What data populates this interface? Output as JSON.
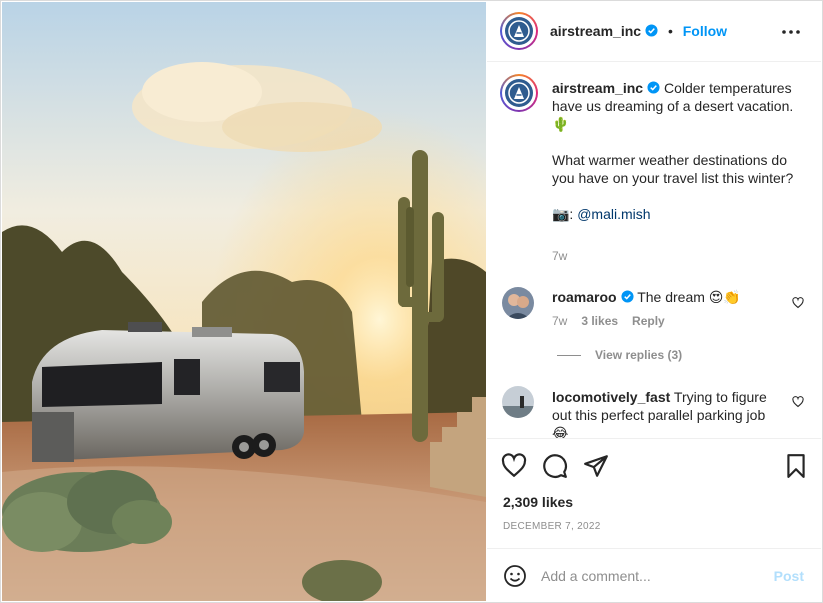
{
  "post": {
    "username": "airstream_inc",
    "follow_label": "Follow",
    "separator": "•",
    "caption_lines": [
      "Colder temperatures have us dreaming of a desert vacation. 🌵",
      "What warmer weather destinations do you have on your travel list this winter?"
    ],
    "photo_credit_icon": "📷:",
    "photo_credit_mention": "@mali.mish",
    "caption_age": "7w"
  },
  "comments": [
    {
      "username": "roamaroo",
      "verified": true,
      "text": "The dream 😍👏",
      "age": "7w",
      "likes": "3 likes",
      "reply_label": "Reply",
      "view_replies": "View replies (3)"
    },
    {
      "username": "locomotively_fast",
      "verified": false,
      "text": "Trying to figure out this perfect parallel parking job 😂"
    }
  ],
  "actions": {
    "likes_count": "2,309 likes",
    "date": "DECEMBER 7, 2022"
  },
  "composer": {
    "placeholder": "Add a comment...",
    "post_label": "Post"
  },
  "colors": {
    "accent": "#0095f6",
    "post_disabled": "#b2dffc",
    "muted": "#8e8e8e"
  },
  "icons": [
    "more-icon",
    "verified-icon",
    "heart-icon",
    "comment-icon",
    "share-icon",
    "bookmark-icon",
    "emoji-icon"
  ]
}
